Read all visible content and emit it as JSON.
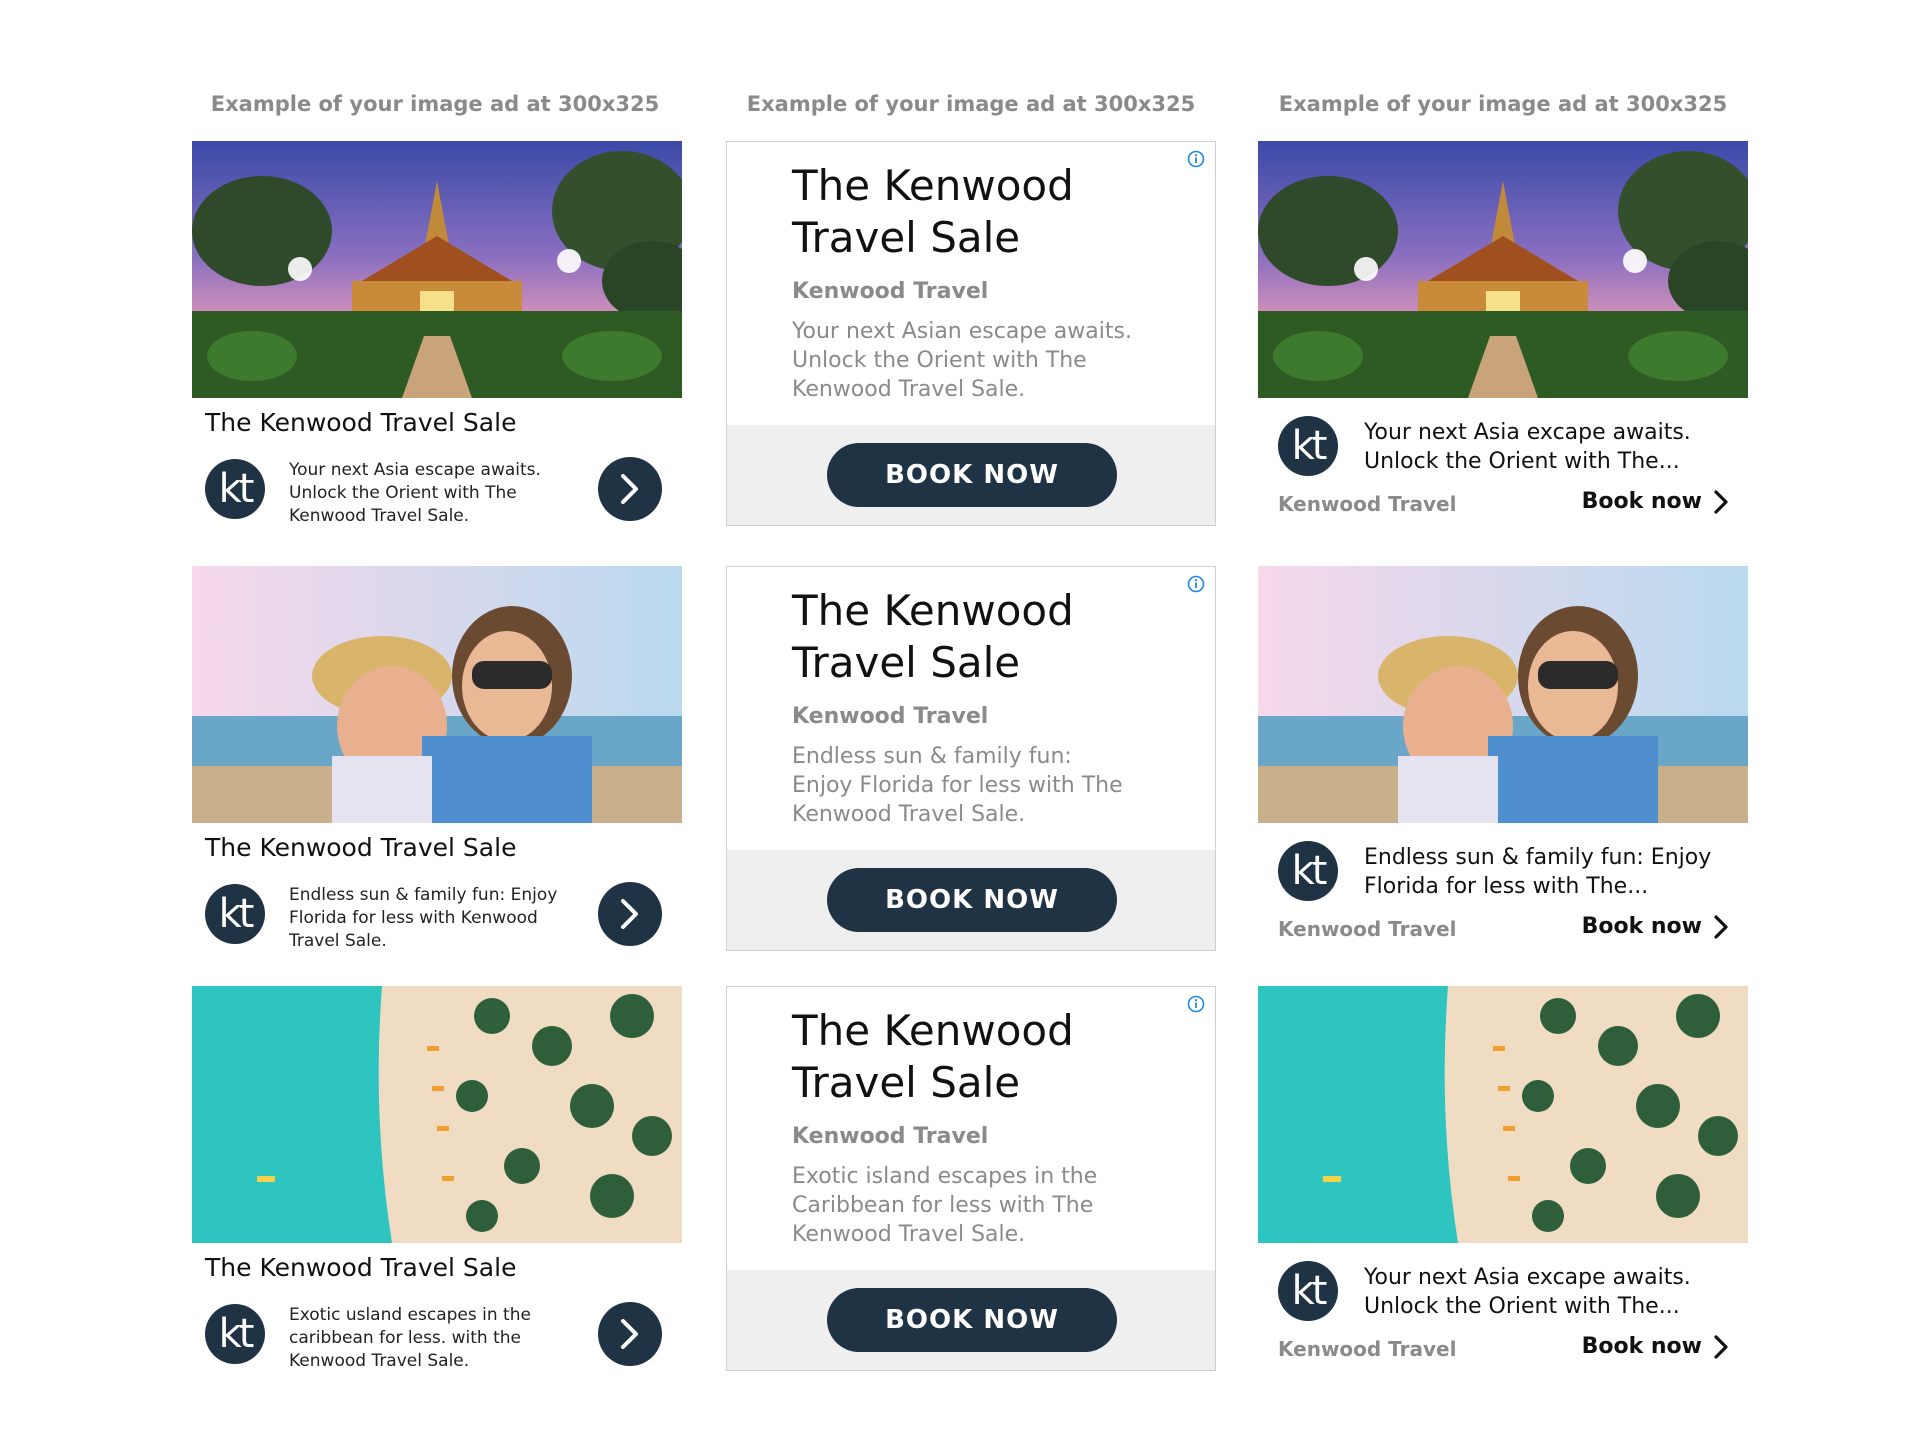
{
  "columns": [
    {
      "heading": "Example of your image ad at 300x325"
    },
    {
      "heading": "Example of your image ad at 300x325"
    },
    {
      "heading": "Example of your image ad at 300x325"
    }
  ],
  "logo_text": "kt",
  "icons": {
    "info": "info-icon",
    "arrow": "chevron-right-icon",
    "cta_arrow": "chevron-right-icon"
  },
  "colors": {
    "navy": "#1f3345",
    "grey_text": "#8a8a8a",
    "info_blue": "#1e88e5",
    "footer_bg": "#efefef"
  },
  "ads_image_card": [
    {
      "image": "temple-photo",
      "title": "The Kenwood Travel Sale",
      "description": "Your next Asia escape awaits. Unlock the Orient with The Kenwood Travel Sale."
    },
    {
      "image": "kids-beach-photo",
      "title": "The Kenwood Travel Sale",
      "description": "Endless sun & family fun: Enjoy Florida for less with Kenwood Travel Sale."
    },
    {
      "image": "aerial-beach-photo",
      "title": "The Kenwood Travel Sale",
      "description": "Exotic usland escapes in the caribbean for less. with the Kenwood Travel Sale."
    }
  ],
  "ads_text": [
    {
      "title": "The Kenwood Travel Sale",
      "advertiser": "Kenwood Travel",
      "description": "Your next Asian escape awaits. Unlock the Orient with The Kenwood Travel Sale.",
      "button": "BOOK NOW"
    },
    {
      "title": "The Kenwood Travel Sale",
      "advertiser": "Kenwood Travel",
      "description": "Endless sun & family fun: Enjoy Florida for less with The Kenwood Travel Sale.",
      "button": "BOOK NOW"
    },
    {
      "title": "The Kenwood Travel Sale",
      "advertiser": "Kenwood Travel",
      "description": "Exotic island escapes in the Caribbean for less with The Kenwood Travel Sale.",
      "button": "BOOK NOW"
    }
  ],
  "ads_native": [
    {
      "image": "temple-photo",
      "description": "Your next  Asia excape awaits. Unlock the Orient with The...",
      "advertiser": "Kenwood Travel",
      "cta": "Book now"
    },
    {
      "image": "kids-beach-photo",
      "description": "Endless sun & family fun: Enjoy Florida for less with The...",
      "advertiser": "Kenwood Travel",
      "cta": "Book now"
    },
    {
      "image": "aerial-beach-photo",
      "description": "Your next  Asia excape awaits. Unlock the Orient with The...",
      "advertiser": "Kenwood Travel",
      "cta": "Book now"
    }
  ]
}
